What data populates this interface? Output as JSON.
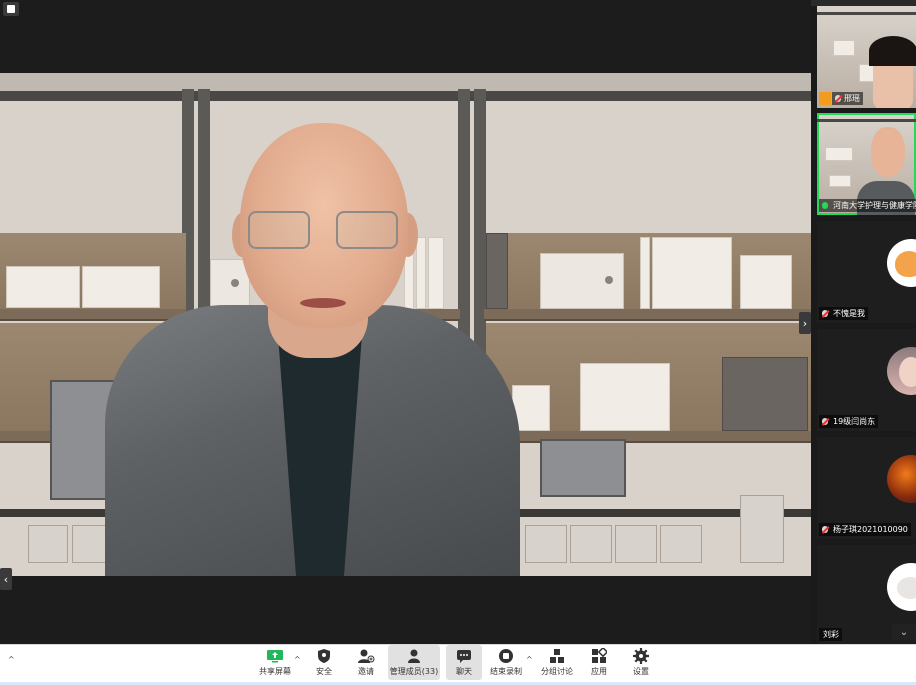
{
  "gallery": {
    "participants": [
      {
        "name": "邢瑶",
        "host": true,
        "muted": true,
        "type": "video"
      },
      {
        "name": "河南大学护理与健康学院",
        "host": false,
        "muted": false,
        "type": "video",
        "active": true
      },
      {
        "name": "不愧是我",
        "muted": true,
        "type": "avatar",
        "avatar": "fox-avatar"
      },
      {
        "name": "19级闫尚东",
        "muted": true,
        "type": "avatar",
        "avatar": "portrait-avatar"
      },
      {
        "name": "杨子琪2021010090",
        "muted": true,
        "type": "avatar",
        "avatar": "planet-avatar"
      },
      {
        "name": "刘彩",
        "muted": false,
        "type": "avatar",
        "avatar": "cat-avatar"
      }
    ]
  },
  "toolbar": {
    "share_label": "共享屏幕",
    "security_label": "安全",
    "invite_label": "邀请",
    "participants_label": "管理成员(33)",
    "chat_label": "聊天",
    "record_label": "结束录制",
    "breakout_label": "分组讨论",
    "apps_label": "应用",
    "settings_label": "设置",
    "left_caret": "^",
    "colors": {
      "share_green": "#1fb85a",
      "active_bg": "#e1e1e1"
    }
  },
  "icons": {
    "nav_left": "‹",
    "nav_right": "›",
    "scroll_down": "⌄",
    "scroll_up": "⌃"
  }
}
